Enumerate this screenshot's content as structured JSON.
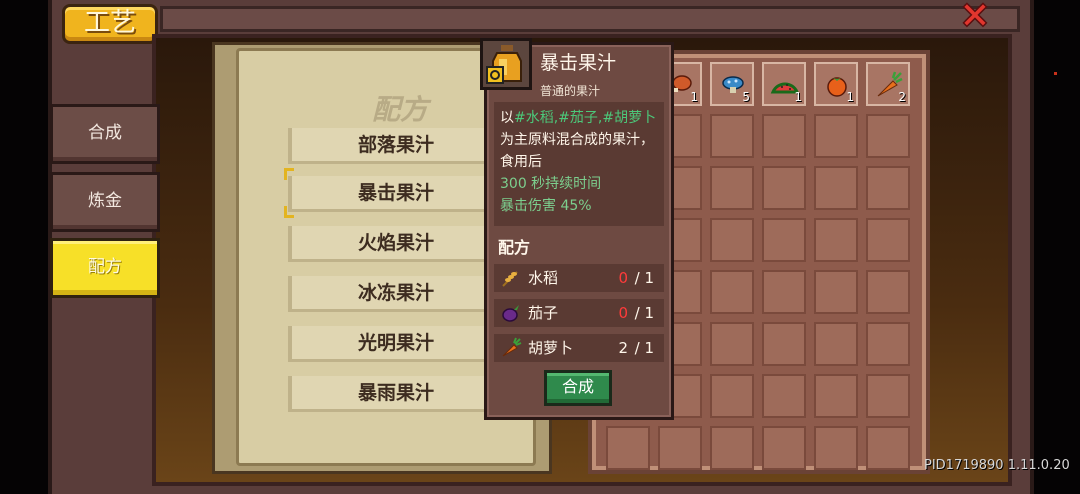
{
  "header": {
    "title": "工艺",
    "close_label": "✕"
  },
  "tabs": [
    {
      "label": "合成",
      "active": false
    },
    {
      "label": "炼金",
      "active": false
    },
    {
      "label": "配方",
      "active": true
    }
  ],
  "book": {
    "title": "配方",
    "recipes": [
      "部落果汁",
      "暴击果汁",
      "火焰果汁",
      "冰冻果汁",
      "光明果汁",
      "暴雨果汁"
    ],
    "selected": "暴击果汁"
  },
  "inventory": {
    "items": [
      {
        "icon": "meat-icon",
        "count": "1"
      },
      {
        "icon": "blue-mushroom-icon",
        "count": "5"
      },
      {
        "icon": "watermelon-icon",
        "count": "1"
      },
      {
        "icon": "tomato-icon",
        "count": "1"
      },
      {
        "icon": "carrot-icon",
        "count": "2"
      }
    ]
  },
  "tooltip": {
    "name": "暴击果汁",
    "subtitle": "普通的果汁",
    "desc_prefix": "以",
    "desc_ingredients": "#水稻,#茄子,#胡萝卜",
    "desc_suffix": "为主原料混合成的果汁，食用后",
    "effect_duration": "300 秒持续时间",
    "effect_stat": "暴击伤害 45%",
    "recipe_label": "配方",
    "ingredients": [
      {
        "name": "水稻",
        "have": "0",
        "need": "/ 1",
        "icon": "rice-icon"
      },
      {
        "name": "茄子",
        "have": "0",
        "need": "/ 1",
        "icon": "eggplant-icon"
      },
      {
        "name": "胡萝卜",
        "have": "2",
        "need": "/ 1",
        "icon": "carrot-icon"
      }
    ],
    "craft_label": "合成"
  },
  "version": "PID1719890 1.11.0.20"
}
